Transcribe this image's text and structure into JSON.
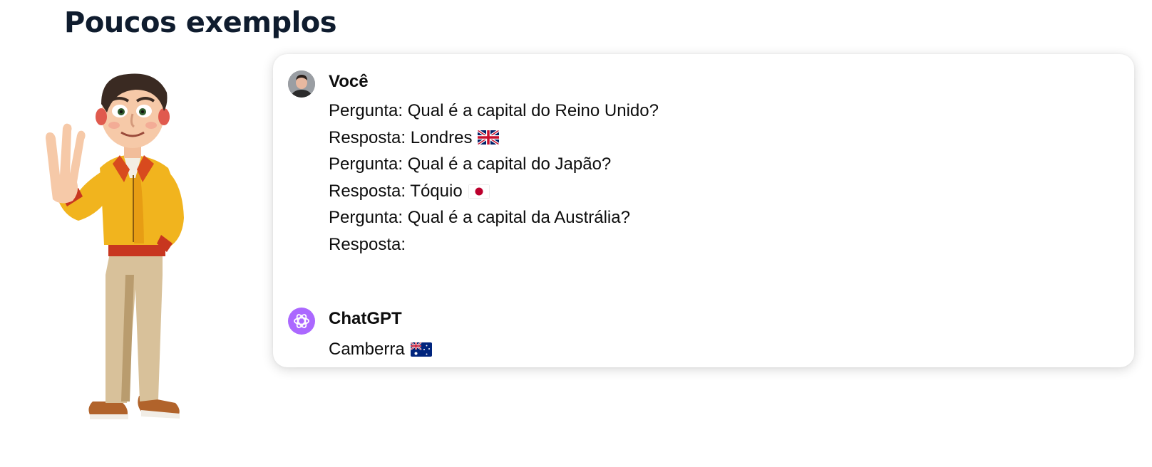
{
  "page": {
    "title": "Poucos exemplos"
  },
  "conversation": {
    "user": {
      "author": "Você",
      "lines": [
        {
          "text": "Pergunta: Qual é a capital do Reino Unido?",
          "flag": ""
        },
        {
          "text": "Resposta: Londres",
          "flag": "uk-flag-icon"
        },
        {
          "text": "Pergunta: Qual é a capital do Japão?",
          "flag": ""
        },
        {
          "text": "Resposta: Tóquio",
          "flag": "japan-flag-icon"
        },
        {
          "text": "Pergunta: Qual é a capital da Austrália?",
          "flag": ""
        },
        {
          "text": "Resposta:",
          "flag": ""
        }
      ]
    },
    "assistant": {
      "author": "ChatGPT",
      "reply": "Camberra",
      "reply_flag": "australia-flag-icon"
    }
  },
  "colors": {
    "title": "#0f1c2e",
    "text": "#0d0d0d",
    "chatgpt_avatar": "#ab68ff"
  }
}
